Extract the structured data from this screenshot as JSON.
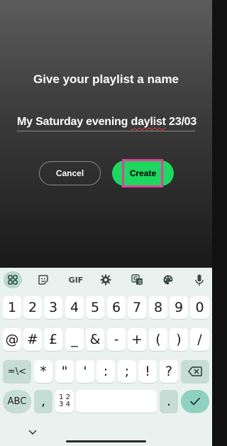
{
  "dialog": {
    "title": "Give your playlist a name",
    "name_part1": "My Saturday evening ",
    "name_misspelled": "daylist",
    "name_part2": " 23/03",
    "cancel_label": "Cancel",
    "create_label": "Create"
  },
  "colors": {
    "accent": "#1ed760",
    "focus_ring": "#e040a0",
    "keyboard_bg": "#eaf2ef"
  },
  "keyboard": {
    "toolbar": {
      "items": [
        "apps-grid-icon",
        "sticker-icon",
        "GIF",
        "settings-gear-icon",
        "translate-icon",
        "palette-icon",
        "microphone-icon"
      ],
      "gif_label": "GIF"
    },
    "row1": [
      "1",
      "2",
      "3",
      "4",
      "5",
      "6",
      "7",
      "8",
      "9",
      "0"
    ],
    "row2": [
      "@",
      "#",
      "£",
      "_",
      "&",
      "-",
      "+",
      "(",
      ")",
      "/"
    ],
    "row3": {
      "shift_label": "=\\<",
      "keys": [
        "*",
        "\"",
        "'",
        ":",
        ";",
        "!",
        "?"
      ]
    },
    "row4": {
      "abc_label": "ABC",
      "comma": ",",
      "numpad_label_top": "1 2",
      "numpad_label_bottom": "3 4",
      "period": "."
    }
  }
}
